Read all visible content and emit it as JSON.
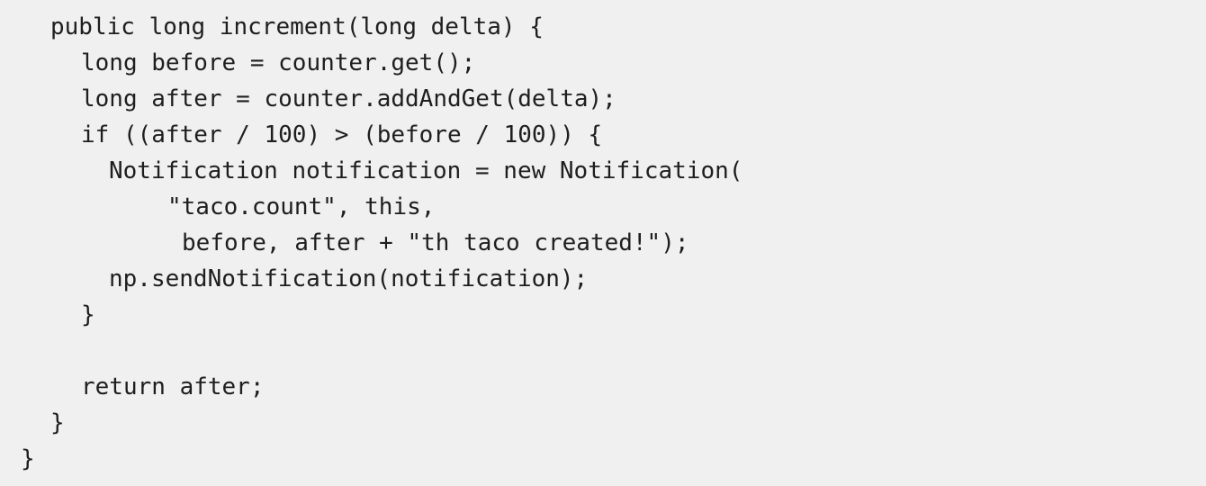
{
  "code": {
    "lines": [
      "public long increment(long delta) {",
      "long before = counter.get();",
      "long after = counter.addAndGet(delta);",
      "if ((after / 100) > (before / 100)) {",
      "Notification notification = new Notification(",
      "\"taco.count\", this,",
      "before, after + \"th taco created!\");",
      "np.sendNotification(notification);",
      "}",
      "",
      "return after;",
      "}",
      "}"
    ]
  }
}
